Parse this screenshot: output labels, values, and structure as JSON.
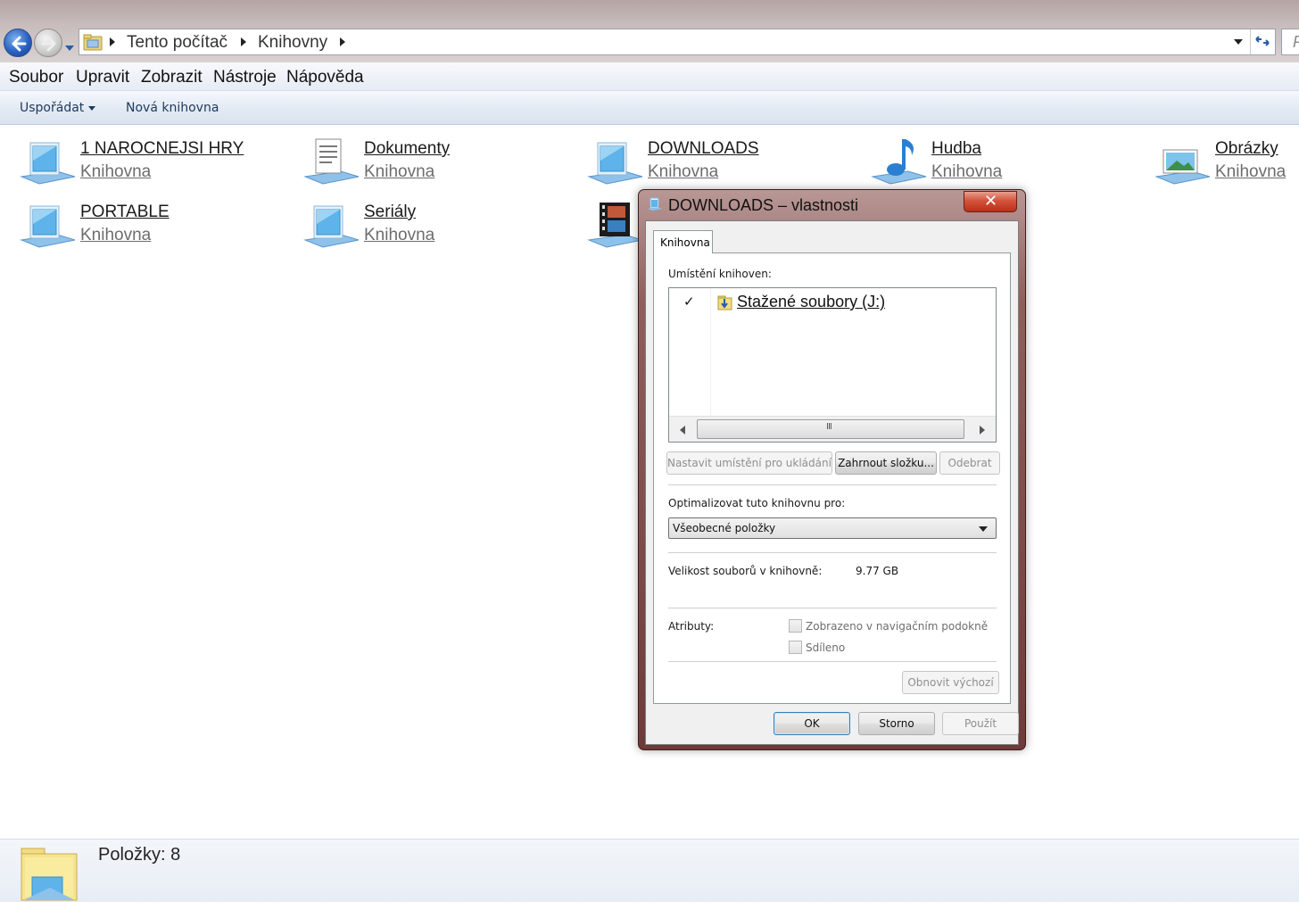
{
  "address_bar": {
    "crumbs": [
      "Tento počítač",
      "Knihovny"
    ],
    "search_placeholder": "P"
  },
  "menu": [
    "Soubor",
    "Upravit",
    "Zobrazit",
    "Nástroje",
    "Nápověda"
  ],
  "toolbar": {
    "organize": "Uspořádat",
    "new_library": "Nová knihovna"
  },
  "libraries": [
    {
      "name": "1 NAROCNEJSI HRY",
      "type": "Knihovna",
      "icon": "library-icon"
    },
    {
      "name": "Dokumenty",
      "type": "Knihovna",
      "icon": "documents-library-icon"
    },
    {
      "name": "DOWNLOADS",
      "type": "Knihovna",
      "icon": "library-icon"
    },
    {
      "name": "Hudba",
      "type": "Knihovna",
      "icon": "music-library-icon"
    },
    {
      "name": "Obrázky",
      "type": "Knihovna",
      "icon": "pictures-library-icon"
    },
    {
      "name": "PORTABLE",
      "type": "Knihovna",
      "icon": "library-icon"
    },
    {
      "name": "Seriály",
      "type": "Knihovna",
      "icon": "library-icon"
    },
    {
      "name": "",
      "type": "",
      "icon": "videos-library-icon"
    }
  ],
  "status": {
    "items": "Položky: 8"
  },
  "dialog": {
    "title": "DOWNLOADS – vlastnosti",
    "close": "✕",
    "tab": "Knihovna",
    "locations_label": "Umístění knihoven:",
    "locations": [
      {
        "checked": "✓",
        "name": "Stažené soubory (J:)"
      }
    ],
    "scroll_grip": "III",
    "btn_set_save": "Nastavit umístění pro ukládání",
    "btn_include": "Zahrnout složku...",
    "btn_remove": "Odebrat",
    "optimize_label": "Optimalizovat tuto knihovnu pro:",
    "optimize_value": "Všeobecné položky",
    "size_label": "Velikost souborů v knihovně:",
    "size_value": "9.77 GB",
    "attributes_label": "Atributy:",
    "attr_nav": "Zobrazeno v navigačním podokně",
    "attr_shared": "Sdíleno",
    "btn_restore": "Obnovit výchozí",
    "btn_ok": "OK",
    "btn_cancel": "Storno",
    "btn_apply": "Použít"
  }
}
